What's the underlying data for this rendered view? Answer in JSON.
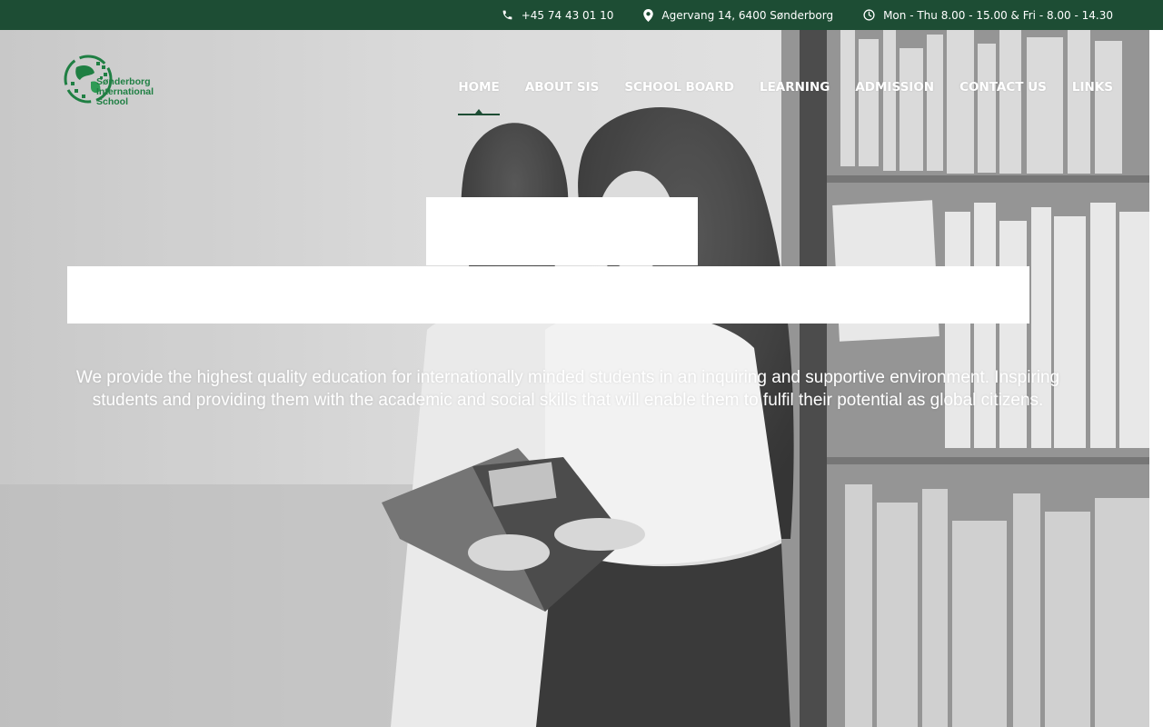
{
  "topbar": {
    "phone": "+45 74 43 01 10",
    "address": "Agervang 14, 6400 Sønderborg",
    "hours": "Mon - Thu 8.00 - 15.00 & Fri - 8.00 - 14.30"
  },
  "logo": {
    "line1": "Sønderborg",
    "line2": "International",
    "line3": "School"
  },
  "nav": {
    "items": [
      {
        "label": "HOME"
      },
      {
        "label": "ABOUT SIS"
      },
      {
        "label": "SCHOOL BOARD"
      },
      {
        "label": "LEARNING"
      },
      {
        "label": "ADMISSION"
      },
      {
        "label": "CONTACT US"
      },
      {
        "label": "LINKS"
      }
    ],
    "active": "HOME"
  },
  "hero": {
    "tagline": "We provide the highest quality education for internationally minded students in an inquiring and supportive environment. Inspiring students and providing them with the academic and social skills that will enable them to fulfil their potential as global citizens."
  },
  "colors": {
    "topbar_bg": "#1d4d34",
    "brand_green": "#1f7f43",
    "nav_text": "#ffffff"
  }
}
